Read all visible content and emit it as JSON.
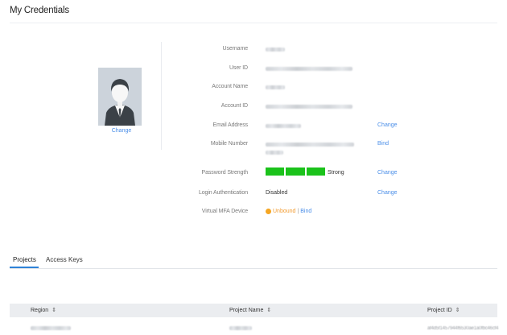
{
  "page": {
    "title": "My Credentials"
  },
  "avatar": {
    "change_label": "Change"
  },
  "fields": {
    "username": {
      "label": "Username"
    },
    "user_id": {
      "label": "User ID"
    },
    "account_name": {
      "label": "Account Name"
    },
    "account_id": {
      "label": "Account ID"
    },
    "email": {
      "label": "Email Address",
      "action": "Change"
    },
    "mobile": {
      "label": "Mobile Number",
      "action": "Bind"
    },
    "password": {
      "label": "Password Strength",
      "strength": "Strong",
      "action": "Change",
      "level": 1.0,
      "color": "#1bc21b"
    },
    "login_auth": {
      "label": "Login Authentication",
      "value": "Disabled",
      "action": "Change"
    },
    "mfa": {
      "label": "Virtual MFA Device",
      "status": "Unbound",
      "separator": "|",
      "action": "Bind",
      "status_color": "#f29a2e"
    }
  },
  "tabs": [
    {
      "label": "Projects",
      "active": true
    },
    {
      "label": "Access Keys",
      "active": false
    }
  ],
  "table": {
    "columns": [
      "Region",
      "Project Name",
      "Project ID"
    ],
    "sort_icon": "⇕",
    "rows": [
      {
        "project_id": "af4d5f1457944f6530ae1a0fbc46cf4"
      }
    ]
  },
  "colors": {
    "link": "#4a8ee8",
    "accent": "#2f83d8"
  }
}
